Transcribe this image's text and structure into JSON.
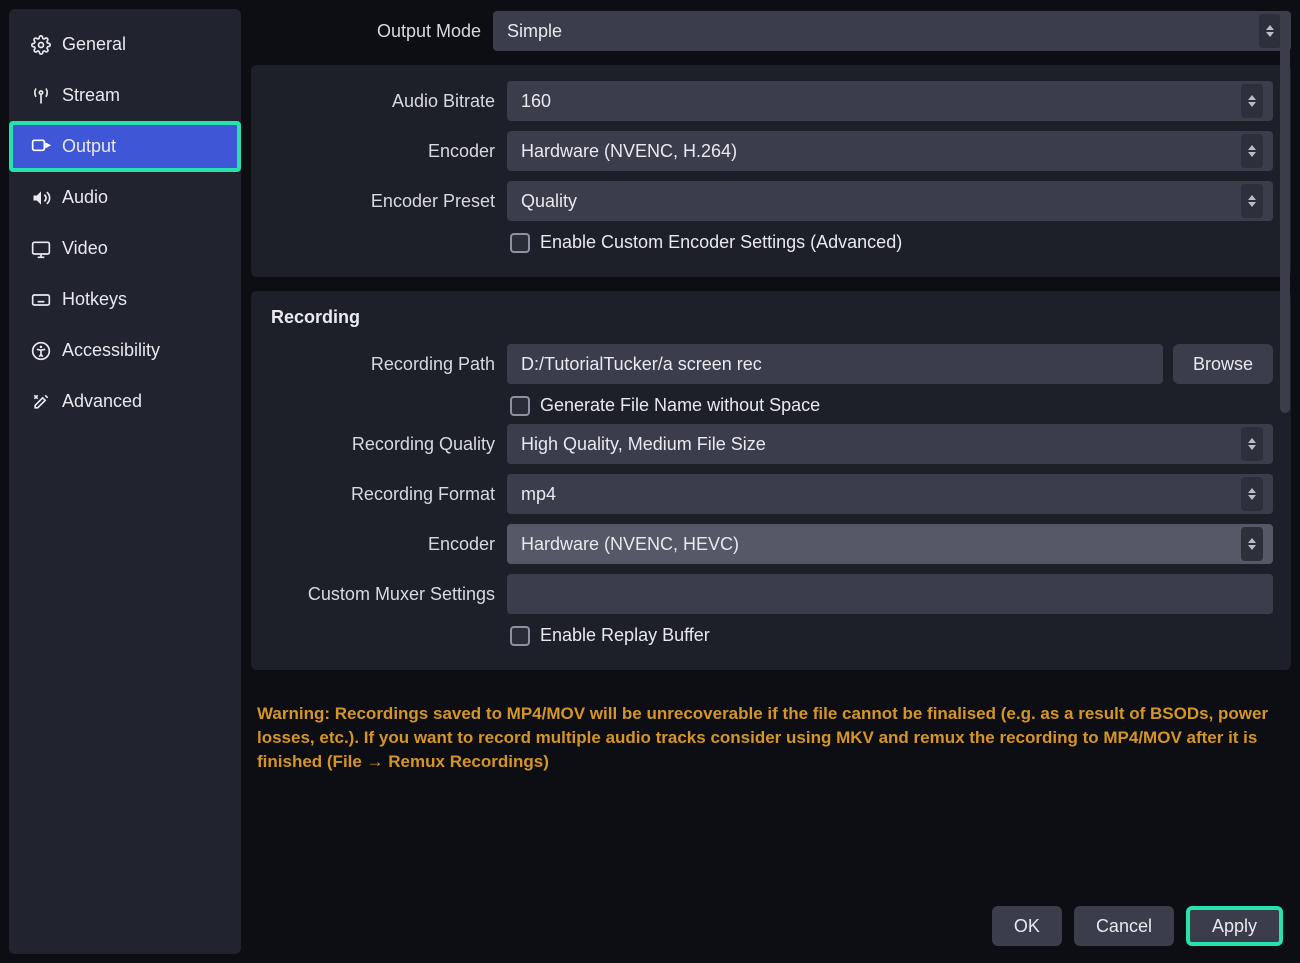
{
  "sidebar": {
    "items": [
      {
        "label": "General",
        "icon": "gear-icon"
      },
      {
        "label": "Stream",
        "icon": "antenna-icon"
      },
      {
        "label": "Output",
        "icon": "output-icon",
        "active": true
      },
      {
        "label": "Audio",
        "icon": "speaker-icon"
      },
      {
        "label": "Video",
        "icon": "monitor-icon"
      },
      {
        "label": "Hotkeys",
        "icon": "keyboard-icon"
      },
      {
        "label": "Accessibility",
        "icon": "accessibility-icon"
      },
      {
        "label": "Advanced",
        "icon": "tools-icon"
      }
    ]
  },
  "settings": {
    "output_mode": {
      "label": "Output Mode",
      "value": "Simple"
    },
    "streaming": {
      "audio_bitrate": {
        "label": "Audio Bitrate",
        "value": "160"
      },
      "encoder": {
        "label": "Encoder",
        "value": "Hardware (NVENC, H.264)"
      },
      "encoder_preset": {
        "label": "Encoder Preset",
        "value": "Quality"
      },
      "enable_custom": {
        "label": "Enable Custom Encoder Settings (Advanced)",
        "checked": false
      }
    },
    "recording": {
      "title": "Recording",
      "path": {
        "label": "Recording Path",
        "value": "D:/TutorialTucker/a screen rec",
        "browse_label": "Browse"
      },
      "gen_no_space": {
        "label": "Generate File Name without Space",
        "checked": false
      },
      "quality": {
        "label": "Recording Quality",
        "value": "High Quality, Medium File Size"
      },
      "format": {
        "label": "Recording Format",
        "value": "mp4"
      },
      "encoder": {
        "label": "Encoder",
        "value": "Hardware (NVENC, HEVC)"
      },
      "muxer": {
        "label": "Custom Muxer Settings",
        "value": ""
      },
      "replay": {
        "label": "Enable Replay Buffer",
        "checked": false
      }
    },
    "warning_text": "Warning: Recordings saved to MP4/MOV will be unrecoverable if the file cannot be finalised (e.g. as a result of BSODs, power losses, etc.). If you want to record multiple audio tracks consider using MKV and remux the recording to MP4/MOV after it is finished (File → Remux Recordings)"
  },
  "footer": {
    "ok": "OK",
    "cancel": "Cancel",
    "apply": "Apply"
  }
}
